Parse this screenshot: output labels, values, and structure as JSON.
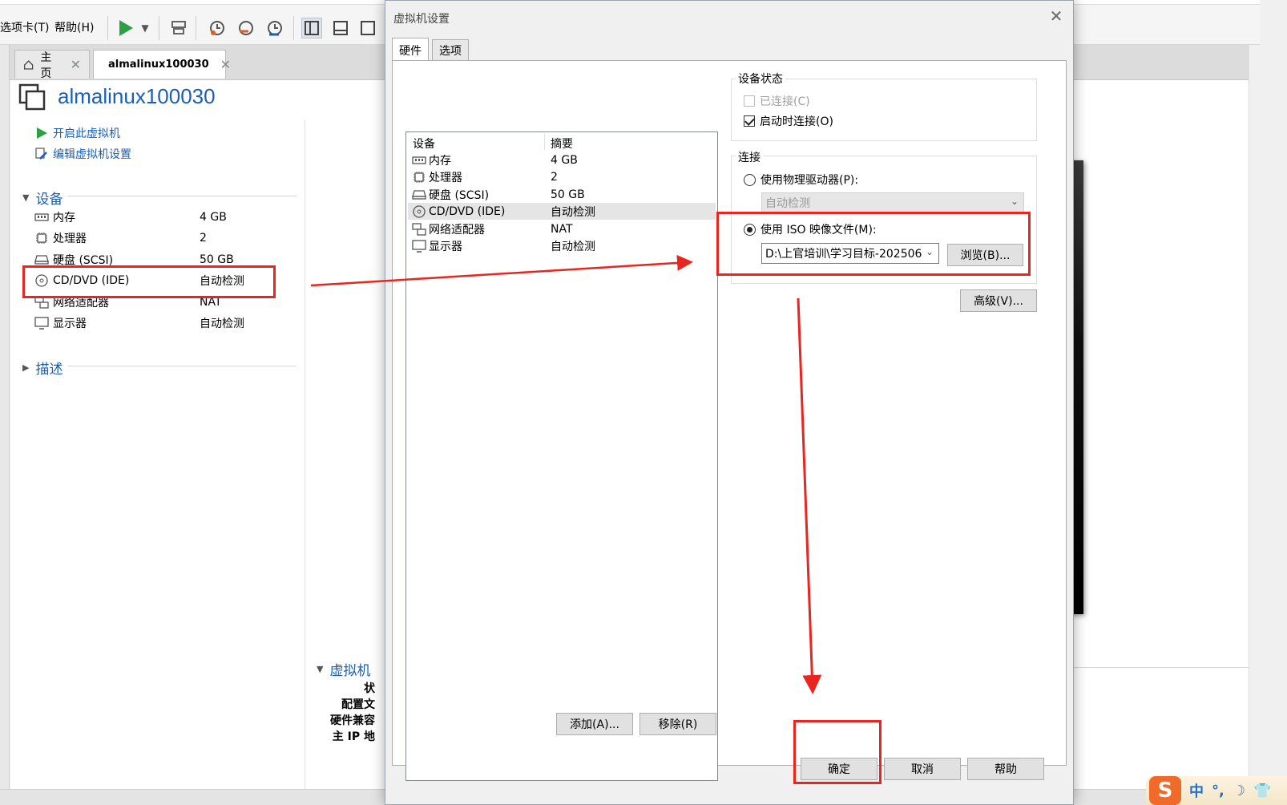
{
  "menu": {
    "tabs_label": "选项卡(T)",
    "help_label": "帮助(H)"
  },
  "toolbar": {
    "icons": [
      "play-icon",
      "dropdown-icon",
      "send-keys-icon",
      "snapshot-icon",
      "revert-snapshot-icon",
      "snapshot-manager-icon",
      "library-view-icon",
      "single-view-icon",
      "fullscreen-icon"
    ]
  },
  "main_tabs": [
    {
      "label": "主页"
    },
    {
      "label": "almalinux100030"
    }
  ],
  "vm": {
    "name": "almalinux100030",
    "actions": {
      "power_on": "开启此虚拟机",
      "edit_settings": "编辑虚拟机设置"
    },
    "devices_heading": "设备",
    "devices": [
      {
        "name": "内存",
        "value": "4 GB",
        "icon": "memory-icon"
      },
      {
        "name": "处理器",
        "value": "2",
        "icon": "processor-icon"
      },
      {
        "name": "硬盘 (SCSI)",
        "value": "50 GB",
        "icon": "hard-disk-icon"
      },
      {
        "name": "CD/DVD (IDE)",
        "value": "自动检测",
        "icon": "cd-dvd-icon"
      },
      {
        "name": "网络适配器",
        "value": "NAT",
        "icon": "network-adapter-icon"
      },
      {
        "name": "显示器",
        "value": "自动检测",
        "icon": "display-icon"
      }
    ],
    "description_heading": "描述",
    "details_heading": "虚拟机",
    "details_labels": [
      "状",
      "配置文",
      "硬件兼容",
      "主 IP 地"
    ]
  },
  "dialog": {
    "title": "虚拟机设置",
    "tabs": [
      {
        "label": "硬件"
      },
      {
        "label": "选项"
      }
    ],
    "hardware_list": {
      "col_device": "设备",
      "col_summary": "摘要",
      "rows": [
        {
          "name": "内存",
          "summary": "4 GB",
          "icon": "memory-icon"
        },
        {
          "name": "处理器",
          "summary": "2",
          "icon": "processor-icon"
        },
        {
          "name": "硬盘 (SCSI)",
          "summary": "50 GB",
          "icon": "hard-disk-icon"
        },
        {
          "name": "CD/DVD (IDE)",
          "summary": "自动检测",
          "icon": "cd-dvd-icon",
          "selected": true
        },
        {
          "name": "网络适配器",
          "summary": "NAT",
          "icon": "network-adapter-icon"
        },
        {
          "name": "显示器",
          "summary": "自动检测",
          "icon": "display-icon"
        }
      ]
    },
    "add_button": "添加(A)...",
    "remove_button": "移除(R)",
    "device_status": {
      "title": "设备状态",
      "connected": "已连接(C)",
      "connected_checked": false,
      "connect_at_power_on": "启动时连接(O)",
      "connect_at_power_on_checked": true
    },
    "connection": {
      "title": "连接",
      "physical_drive": "使用物理驱动器(P):",
      "physical_drive_value": "自动检测",
      "iso_image": "使用 ISO 映像文件(M):",
      "iso_path": "D:\\上官培训\\学习目标-202506",
      "browse": "浏览(B)...",
      "selected": "iso"
    },
    "advanced_button": "高级(V)...",
    "ok_button": "确定",
    "cancel_button": "取消",
    "help_button": "帮助"
  },
  "ime": {
    "logo": "S",
    "mode": "中",
    "punct": "°,",
    "moon": "☽",
    "shirt": "👕"
  },
  "colors": {
    "link": "#1a5fb4",
    "annotation": "#e8261f",
    "play_green": "#2ea043"
  }
}
